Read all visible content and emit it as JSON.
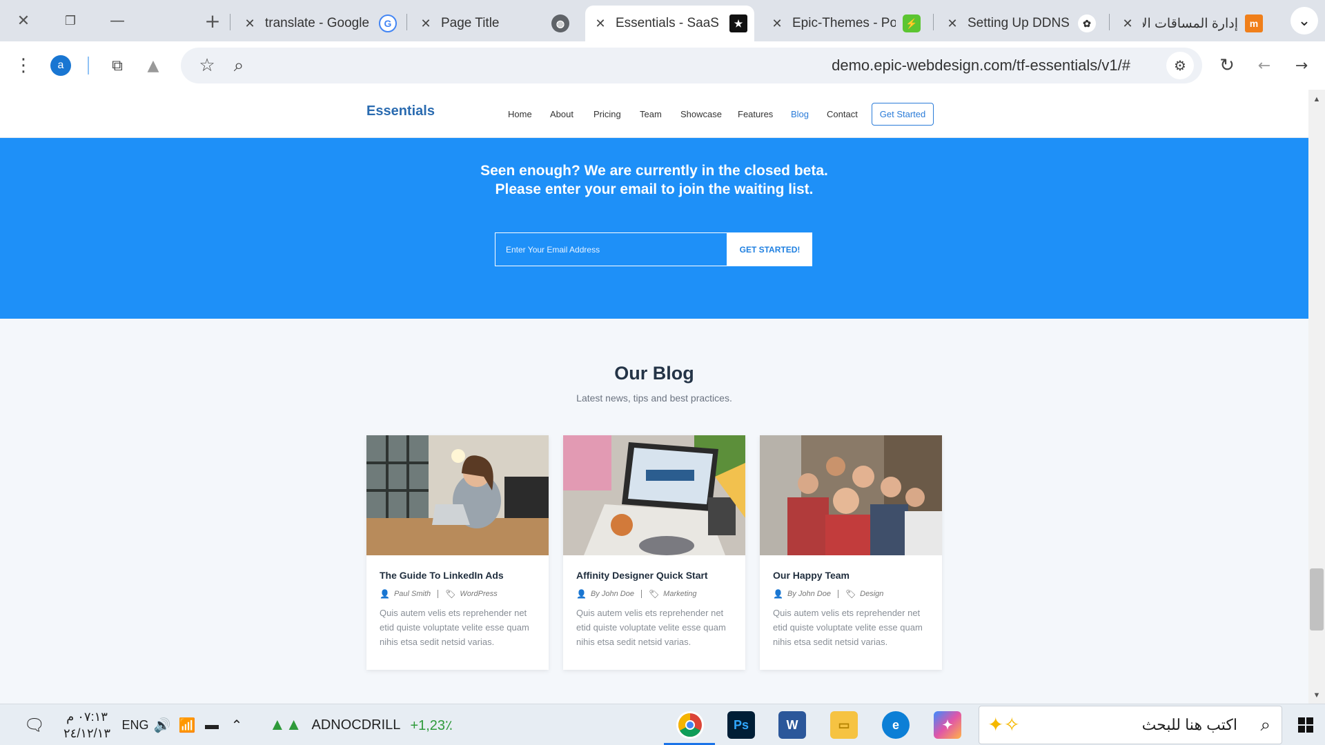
{
  "window": {
    "close_glyph": "✕",
    "restore_glyph": "❐",
    "minimize_glyph": "—",
    "newtab_glyph": "+",
    "dropdown_glyph": "⌄"
  },
  "tabs": [
    {
      "title": "translate - Google",
      "favicon": "google-icon",
      "color": "#4285f4",
      "glyph": "G"
    },
    {
      "title": "Page Title",
      "favicon": "globe-icon",
      "color": "#5f6368",
      "glyph": "◍"
    },
    {
      "title": "Essentials - SaaS La",
      "favicon": "star-icon",
      "color": "#111111",
      "glyph": "★"
    },
    {
      "title": "Epic-Themes - Port",
      "favicon": "epic-themes-icon",
      "color": "#5cc531",
      "glyph": "⚡"
    },
    {
      "title": "Setting Up DDNS",
      "favicon": "openai-icon",
      "color": "#333333",
      "glyph": "✿"
    },
    {
      "title": "إدارة المساقات الإلك",
      "favicon": "moodle-icon",
      "color": "#f07f1a",
      "glyph": "m"
    }
  ],
  "toolbar": {
    "url": "demo.epic-webdesign.com/tf-essentials/v1/#",
    "menu_glyph": "⋮",
    "avatar_letter": "a",
    "extensions_glyph": "⧉",
    "bookmark_glyph": "☆",
    "zoom_glyph": "⌕",
    "reload_glyph": "↻",
    "back_glyph": "←",
    "forward_glyph": "→",
    "site_settings_glyph": "⚙"
  },
  "site": {
    "logo": "Essentials",
    "nav": [
      "Home",
      "About",
      "Pricing",
      "Team",
      "Showcase",
      "Features",
      "Blog",
      "Contact"
    ],
    "nav_active": "Blog",
    "cta": "Get Started",
    "accent": "#1e90f8"
  },
  "beta": {
    "line1": "Seen enough? We are currently in the closed beta.",
    "line2": "Please enter your email to join the waiting list.",
    "input_placeholder": "Enter Your Email Address",
    "button": "GET STARTED!"
  },
  "blog": {
    "title": "Our Blog",
    "subtitle": "Latest news, tips and best practices.",
    "posts": [
      {
        "title": "The Guide To LinkedIn Ads",
        "author": "Paul Smith",
        "category": "WordPress",
        "excerpt": "Quis autem velis ets reprehender net etid quiste voluptate velite esse quam nihis etsa sedit netsid varias."
      },
      {
        "title": "Affinity Designer Quick Start",
        "author": "By John Doe",
        "category": "Marketing",
        "excerpt": "Quis autem velis ets reprehender net etid quiste voluptate velite esse quam nihis etsa sedit netsid varias."
      },
      {
        "title": "Our Happy Team",
        "author": "By John Doe",
        "category": "Design",
        "excerpt": "Quis autem velis ets reprehender net etid quiste voluptate velite esse quam nihis etsa sedit netsid varias."
      }
    ]
  },
  "taskbar": {
    "time": "٠٧:١٣ م",
    "date": "٢٤/١٢/١٣",
    "lang": "ENG",
    "stock_name": "ADNOCDRILL",
    "stock_change": "+1,23٪",
    "stock_color": "#2e9a3a",
    "search_placeholder": "اكتب هنا للبحث",
    "apps": [
      "chrome-icon",
      "photoshop-icon",
      "word-icon",
      "file-explorer-icon",
      "edge-icon",
      "copilot-icon"
    ]
  }
}
